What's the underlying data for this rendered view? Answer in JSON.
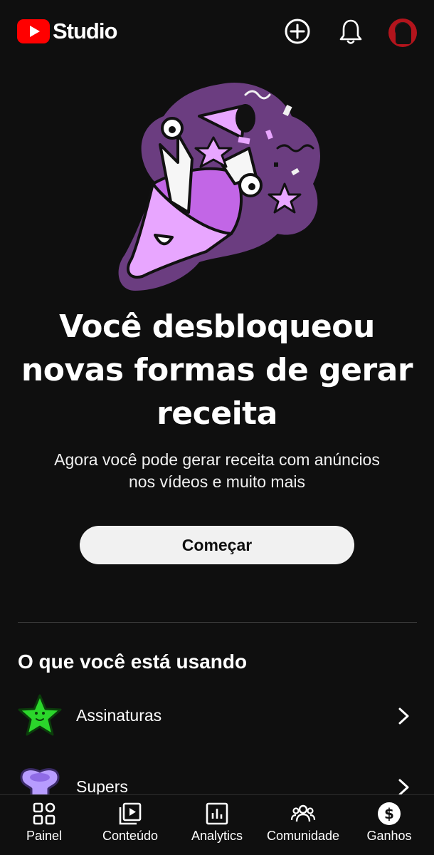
{
  "header": {
    "logo_text": "Studio",
    "icons": [
      "create-icon",
      "notifications-icon",
      "account-avatar"
    ]
  },
  "promo": {
    "headline_line1": "Você desbloqueou",
    "headline_line2": "novas formas de gerar",
    "headline_line3": "receita",
    "subtext_line1": "Agora você pode gerar receita com anúncios",
    "subtext_line2": "nos vídeos e muito mais",
    "cta_label": "Começar"
  },
  "section": {
    "title": "O que você está usando",
    "items": [
      {
        "label": "Assinaturas",
        "icon": "green-star-icon"
      },
      {
        "label": "Supers",
        "icon": "purple-character-icon"
      }
    ]
  },
  "bottom_nav": {
    "items": [
      {
        "label": "Painel",
        "icon": "dashboard-icon"
      },
      {
        "label": "Conteúdo",
        "icon": "content-icon"
      },
      {
        "label": "Analytics",
        "icon": "analytics-icon"
      },
      {
        "label": "Comunidade",
        "icon": "community-icon"
      },
      {
        "label": "Ganhos",
        "icon": "earnings-icon"
      }
    ],
    "selected": "Ganhos"
  },
  "colors": {
    "background": "#0f0f0f",
    "brand_red": "#ff0000",
    "illustration_purple": "#6b3d80",
    "illustration_pink": "#e8a6ff",
    "button_bg": "#f1f1f1",
    "star_green": "#2bd62b",
    "supers_purple": "#b79cff"
  }
}
